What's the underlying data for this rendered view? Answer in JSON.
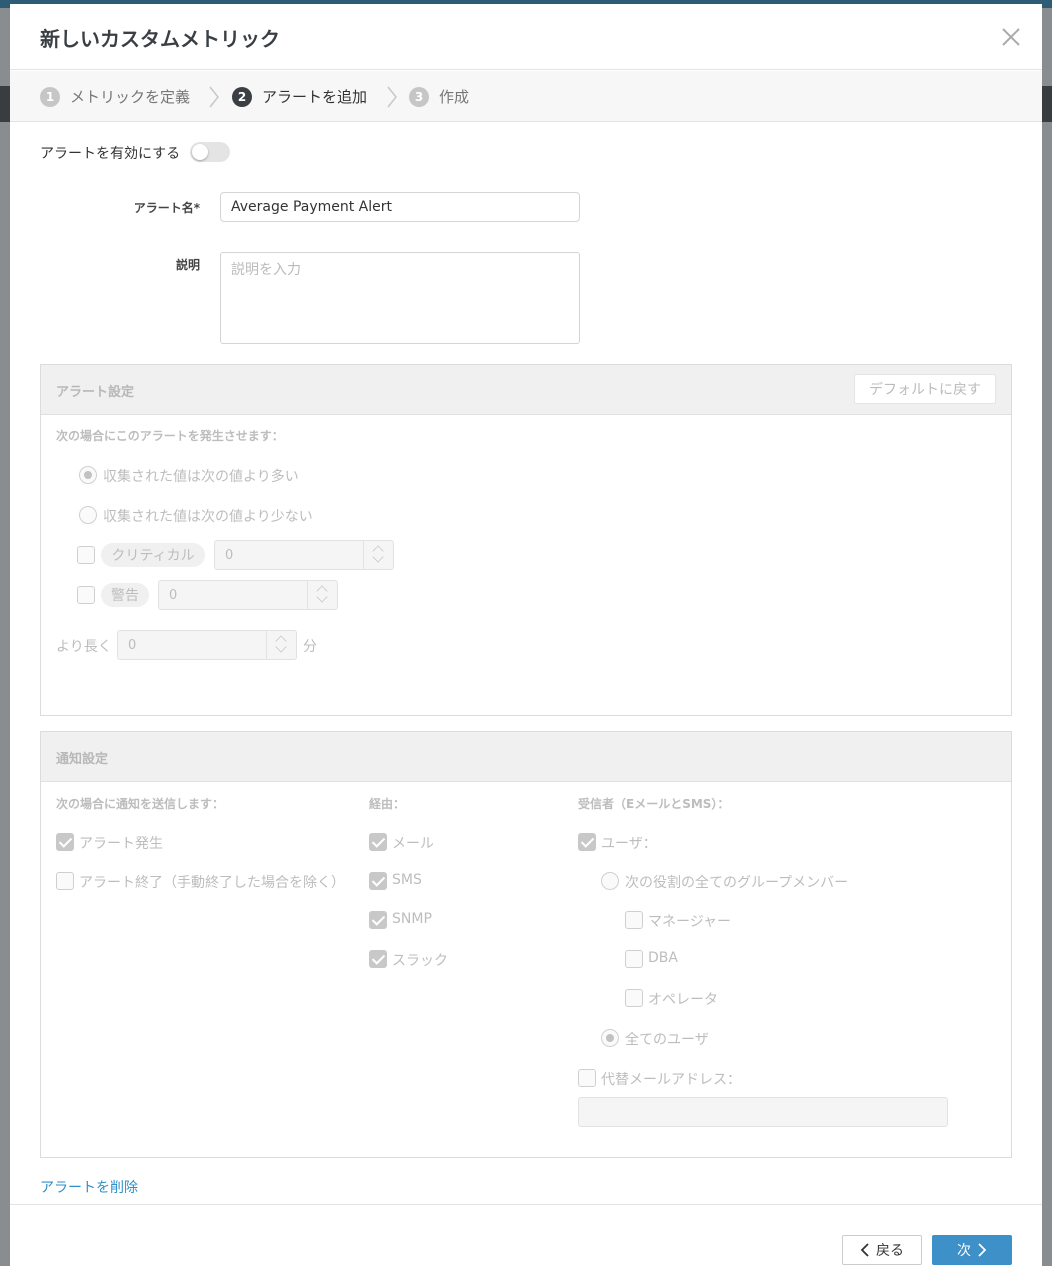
{
  "dialog": {
    "title": "新しいカスタムメトリック"
  },
  "steps": [
    {
      "num": "1",
      "label": "メトリックを定義"
    },
    {
      "num": "2",
      "label": "アラートを追加"
    },
    {
      "num": "3",
      "label": "作成"
    }
  ],
  "enable": {
    "label": "アラートを有効にする",
    "on": false
  },
  "form": {
    "name_label": "アラート名*",
    "name_value": "Average Payment Alert",
    "desc_label": "説明",
    "desc_placeholder": "説明を入力"
  },
  "alert_settings": {
    "title": "アラート設定",
    "reset_button": "デフォルトに戻す",
    "condition_label": "次の場合にこのアラートを発生させます：",
    "radio_greater": "収集された値は次の値より多い",
    "radio_less": "収集された値は次の値より少ない",
    "critical_label": "クリティカル",
    "critical_value": "0",
    "warning_label": "警告",
    "warning_value": "0",
    "longer_label": "より長く",
    "longer_value": "0",
    "minutes_unit": "分"
  },
  "notify_settings": {
    "title": "通知設定",
    "when_label": "次の場合に通知を送信します：",
    "when_raised": "アラート発生",
    "when_closed": "アラート終了（手動終了した場合を除く）",
    "via_label": "経由：",
    "via": [
      "メール",
      "SMS",
      "SNMP",
      "スラック"
    ],
    "recipients_label": "受信者（EメールとSMS）：",
    "users_label": "ユーザ：",
    "group_radio": "次の役割の全てのグループメンバー",
    "roles": [
      "マネージャー",
      "DBA",
      "オペレータ"
    ],
    "all_users": "全てのユーザ",
    "alt_email_label": "代替メールアドレス：",
    "alt_email_value": ""
  },
  "delete_link": "アラートを削除",
  "footer": {
    "back": "戻る",
    "next": "次"
  }
}
